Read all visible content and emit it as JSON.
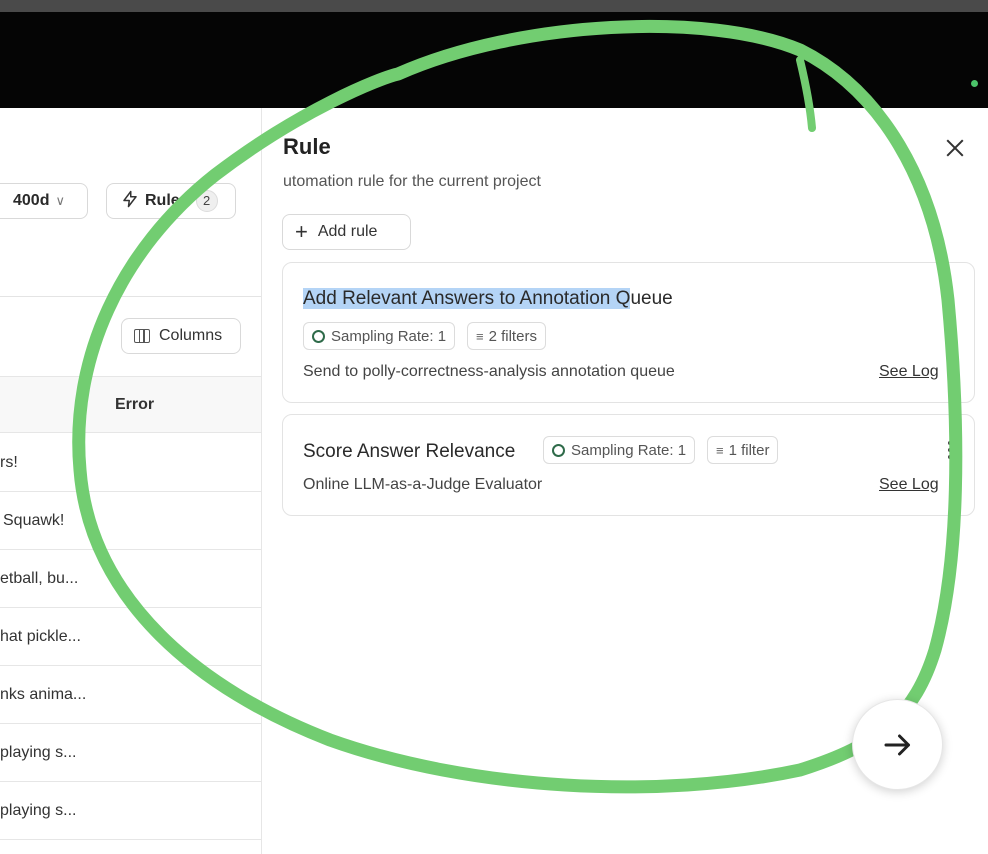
{
  "left_page": {
    "time_range": "400d",
    "rules_button": {
      "label": "Rules",
      "count": "2"
    },
    "columns_button": "Columns",
    "table": {
      "column_header": "Error",
      "rows": [
        "rs!",
        "Squawk!",
        "etball, bu...",
        "hat pickle...",
        "nks anima...",
        "playing s...",
        "playing s..."
      ]
    }
  },
  "drawer": {
    "title": "Rule",
    "subtitle": "utomation rule for the current project",
    "add_rule_label": "Add rule",
    "rules": [
      {
        "name_highlighted": "Add Relevant Answers to Annotation Q",
        "name_rest": "ueue",
        "sampling": "Sampling Rate: 1",
        "filters": "2 filters",
        "description_prefix": "Send to ",
        "description_target": "polly-correctness-analysis",
        "description_suffix": " annotation queue",
        "logs_link": "See Log"
      },
      {
        "name": "Score Answer Relevance",
        "sampling": "Sampling Rate: 1",
        "filters": "1 filter",
        "description": "Online LLM-as-a-Judge Evaluator",
        "logs_link": "See Log"
      }
    ]
  },
  "colors": {
    "annotation_stroke": "#72cd71",
    "highlight": "#b4d4f6",
    "sampling_ring": "#2f6b4a",
    "top_bar": "#050505"
  },
  "icons": [
    "chevron-down-icon",
    "bolt-icon",
    "columns-icon",
    "close-icon",
    "plus-icon",
    "sampling-ring-icon",
    "filter-icon",
    "kebab-menu-icon",
    "arrow-right-icon"
  ]
}
